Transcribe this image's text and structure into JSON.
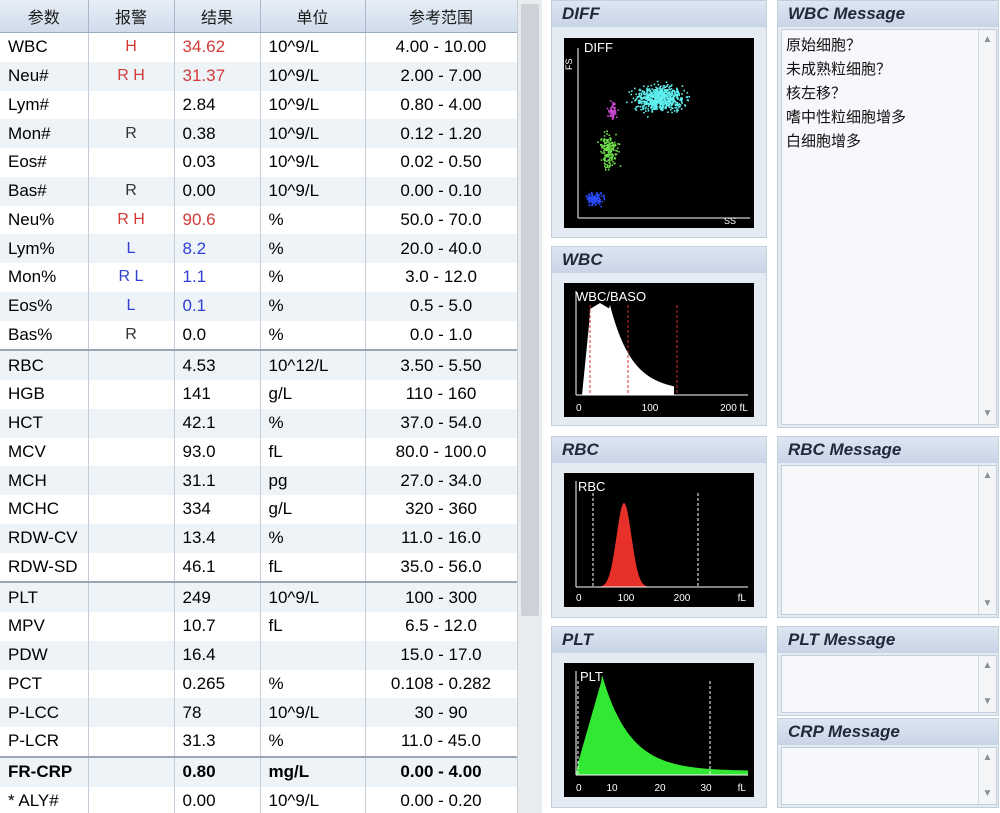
{
  "table": {
    "headers": [
      "参数",
      "报警",
      "结果",
      "单位",
      "参考范围"
    ],
    "rows": [
      {
        "param": "WBC",
        "flag": "H",
        "flag_color": "red",
        "result": "34.62",
        "result_color": "red",
        "unit": "10^9/L",
        "range": "4.00 - 10.00"
      },
      {
        "param": "Neu#",
        "flag": "R H",
        "flag_color": "red",
        "result": "31.37",
        "result_color": "red",
        "unit": "10^9/L",
        "range": "2.00 - 7.00"
      },
      {
        "param": "Lym#",
        "flag": "",
        "flag_color": "dark",
        "result": "2.84",
        "result_color": "black",
        "unit": "10^9/L",
        "range": "0.80 - 4.00"
      },
      {
        "param": "Mon#",
        "flag": "R",
        "flag_color": "dark",
        "result": "0.38",
        "result_color": "black",
        "unit": "10^9/L",
        "range": "0.12 - 1.20"
      },
      {
        "param": "Eos#",
        "flag": "",
        "flag_color": "dark",
        "result": "0.03",
        "result_color": "black",
        "unit": "10^9/L",
        "range": "0.02 - 0.50"
      },
      {
        "param": "Bas#",
        "flag": "R",
        "flag_color": "dark",
        "result": "0.00",
        "result_color": "black",
        "unit": "10^9/L",
        "range": "0.00 - 0.10"
      },
      {
        "param": "Neu%",
        "flag": "R H",
        "flag_color": "red",
        "result": "90.6",
        "result_color": "red",
        "unit": "%",
        "range": "50.0 - 70.0"
      },
      {
        "param": "Lym%",
        "flag": "L",
        "flag_color": "blue",
        "result": "8.2",
        "result_color": "blue",
        "unit": "%",
        "range": "20.0 - 40.0"
      },
      {
        "param": "Mon%",
        "flag": "R L",
        "flag_color": "blue",
        "result": "1.1",
        "result_color": "blue",
        "unit": "%",
        "range": "3.0 - 12.0"
      },
      {
        "param": "Eos%",
        "flag": "L",
        "flag_color": "blue",
        "result": "0.1",
        "result_color": "blue",
        "unit": "%",
        "range": "0.5 - 5.0"
      },
      {
        "param": "Bas%",
        "flag": "R",
        "flag_color": "dark",
        "result": "0.0",
        "result_color": "black",
        "unit": "%",
        "range": "0.0 - 1.0"
      },
      {
        "param": "RBC",
        "flag": "",
        "flag_color": "dark",
        "result": "4.53",
        "result_color": "black",
        "unit": "10^12/L",
        "range": "3.50 - 5.50",
        "group_start": true
      },
      {
        "param": "HGB",
        "flag": "",
        "flag_color": "dark",
        "result": "141",
        "result_color": "black",
        "unit": "g/L",
        "range": "110 - 160"
      },
      {
        "param": "HCT",
        "flag": "",
        "flag_color": "dark",
        "result": "42.1",
        "result_color": "black",
        "unit": "%",
        "range": "37.0 - 54.0"
      },
      {
        "param": "MCV",
        "flag": "",
        "flag_color": "dark",
        "result": "93.0",
        "result_color": "black",
        "unit": "fL",
        "range": "80.0 - 100.0"
      },
      {
        "param": "MCH",
        "flag": "",
        "flag_color": "dark",
        "result": "31.1",
        "result_color": "black",
        "unit": "pg",
        "range": "27.0 - 34.0"
      },
      {
        "param": "MCHC",
        "flag": "",
        "flag_color": "dark",
        "result": "334",
        "result_color": "black",
        "unit": "g/L",
        "range": "320 - 360"
      },
      {
        "param": "RDW-CV",
        "flag": "",
        "flag_color": "dark",
        "result": "13.4",
        "result_color": "black",
        "unit": "%",
        "range": "11.0 - 16.0"
      },
      {
        "param": "RDW-SD",
        "flag": "",
        "flag_color": "dark",
        "result": "46.1",
        "result_color": "black",
        "unit": "fL",
        "range": "35.0 - 56.0"
      },
      {
        "param": "PLT",
        "flag": "",
        "flag_color": "dark",
        "result": "249",
        "result_color": "black",
        "unit": "10^9/L",
        "range": "100 - 300",
        "group_start": true
      },
      {
        "param": "MPV",
        "flag": "",
        "flag_color": "dark",
        "result": "10.7",
        "result_color": "black",
        "unit": "fL",
        "range": "6.5 - 12.0"
      },
      {
        "param": "PDW",
        "flag": "",
        "flag_color": "dark",
        "result": "16.4",
        "result_color": "black",
        "unit": "",
        "range": "15.0 - 17.0"
      },
      {
        "param": "PCT",
        "flag": "",
        "flag_color": "dark",
        "result": "0.265",
        "result_color": "black",
        "unit": "%",
        "range": "0.108 - 0.282"
      },
      {
        "param": "P-LCC",
        "flag": "",
        "flag_color": "dark",
        "result": "78",
        "result_color": "black",
        "unit": "10^9/L",
        "range": "30 - 90"
      },
      {
        "param": "P-LCR",
        "flag": "",
        "flag_color": "dark",
        "result": "31.3",
        "result_color": "black",
        "unit": "%",
        "range": "11.0 - 45.0"
      },
      {
        "param": "FR-CRP",
        "flag": "",
        "flag_color": "dark",
        "result": "0.80",
        "result_color": "black",
        "unit": "mg/L",
        "range": "0.00 - 4.00",
        "group_start": true,
        "bold": true
      },
      {
        "param": "* ALY#",
        "flag": "",
        "flag_color": "dark",
        "result": "0.00",
        "result_color": "black",
        "unit": "10^9/L",
        "range": "0.00 - 0.20"
      }
    ]
  },
  "colors": {
    "red": "#d23a3a",
    "blue": "#2f3fd2",
    "dark": "#333333",
    "black": "#000000",
    "rbc_fill": "#e8302a",
    "plt_fill": "#33e833",
    "wbc_fill": "#ffffff"
  },
  "diff": {
    "title": "DIFF",
    "plot_label": "DIFF",
    "y_axis": "FS",
    "x_axis": "SS"
  },
  "wbc": {
    "title": "WBC",
    "plot_label": "WBC/BASO",
    "ticks": [
      "0",
      "100",
      "200 fL"
    ]
  },
  "rbc": {
    "title": "RBC",
    "plot_label": "RBC",
    "ticks": [
      "0",
      "100",
      "200",
      "fL"
    ]
  },
  "plt": {
    "title": "PLT",
    "plot_label": "PLT",
    "ticks": [
      "0",
      "10",
      "20",
      "30",
      "fL"
    ]
  },
  "messages": {
    "wbc_title": "WBC Message",
    "wbc_lines": [
      "原始细胞？",
      "未成熟粒细胞？",
      "核左移？",
      "嗜中性粒细胞增多",
      "白细胞增多"
    ],
    "rbc_title": "RBC Message",
    "plt_title": "PLT Message",
    "crp_title": "CRP Message"
  },
  "scroll": {
    "up": "▲",
    "down": "▼"
  }
}
